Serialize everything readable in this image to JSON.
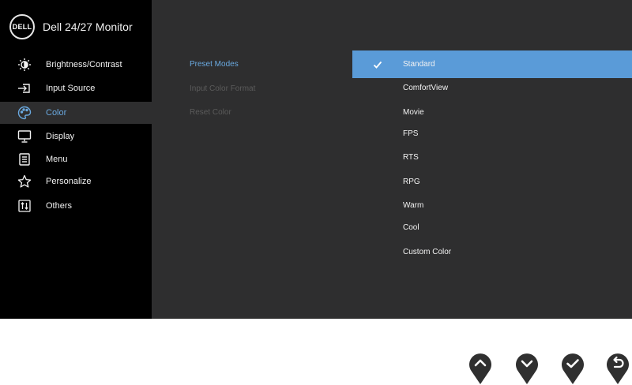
{
  "header": {
    "logo_text": "DELL",
    "model_title": "Dell 24/27 Monitor"
  },
  "sidebar": {
    "items": [
      {
        "label": "Brightness/Contrast",
        "icon": "brightness-icon"
      },
      {
        "label": "Input Source",
        "icon": "input-source-icon"
      },
      {
        "label": "Color",
        "icon": "color-palette-icon",
        "active": true
      },
      {
        "label": "Display",
        "icon": "display-icon"
      },
      {
        "label": "Menu",
        "icon": "menu-icon"
      },
      {
        "label": "Personalize",
        "icon": "star-icon"
      },
      {
        "label": "Others",
        "icon": "others-icon"
      }
    ]
  },
  "submenu": {
    "items": [
      {
        "label": "Preset Modes",
        "active": true
      },
      {
        "label": "Input Color Format",
        "active": false
      },
      {
        "label": "Reset Color",
        "active": false
      }
    ]
  },
  "options": {
    "items": [
      {
        "label": "Standard",
        "selected": true
      },
      {
        "label": "ComfortView"
      },
      {
        "label": "Movie"
      },
      {
        "label": "FPS"
      },
      {
        "label": "RTS"
      },
      {
        "label": "RPG"
      },
      {
        "label": "Warm"
      },
      {
        "label": "Cool"
      },
      {
        "label": "Custom Color"
      }
    ]
  },
  "buttons": [
    {
      "icon": "chevron-up-icon"
    },
    {
      "icon": "chevron-down-icon"
    },
    {
      "icon": "check-icon"
    },
    {
      "icon": "back-icon"
    }
  ],
  "colors": {
    "accent": "#6aa9e0",
    "selected_bg": "#5a9bd8",
    "panel_bg": "#2e2e2f",
    "sidebar_bg": "#000000",
    "button_bg": "#303030"
  }
}
